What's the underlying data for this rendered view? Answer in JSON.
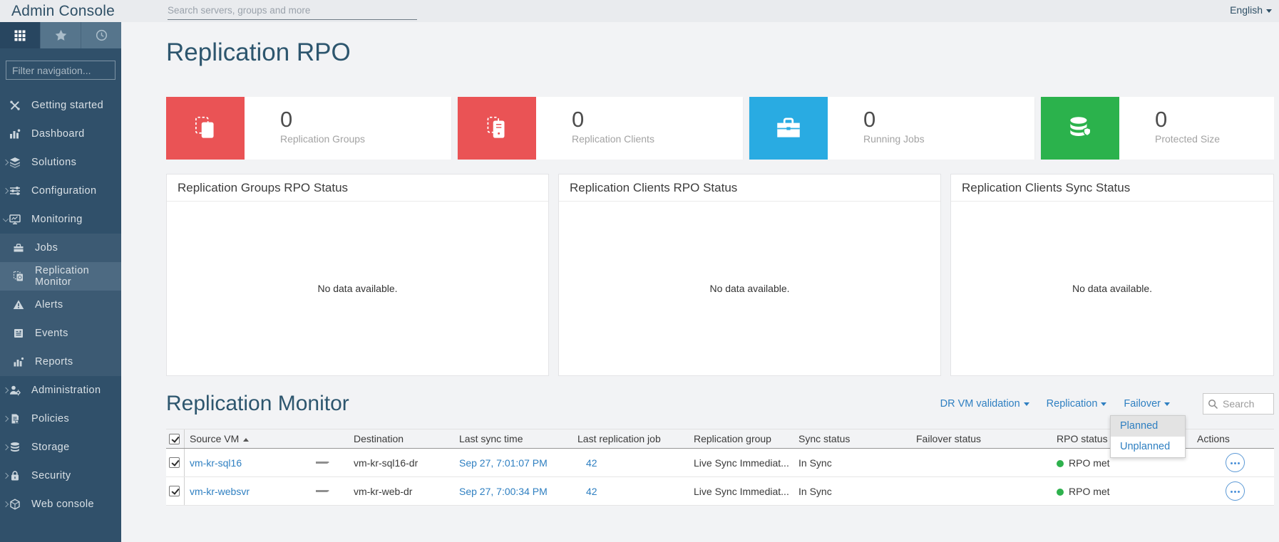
{
  "colors": {
    "sidebar_bg": "#30506a",
    "sidebar_subgroup_bg": "#3c5a73",
    "sidebar_selected_bg": "#4d6a82",
    "topbar_bg": "#e9ebee",
    "page_bg": "#f2f3f5",
    "heading": "#2d566e",
    "link": "#2e7fc1",
    "card_red": "#ea5355",
    "card_blue": "#29abe2",
    "card_green": "#2bb24c",
    "rpo_met_dot": "#2eb14d"
  },
  "topbar": {
    "app_title": "Admin Console",
    "search_placeholder": "Search servers, groups and more",
    "language_label": "English"
  },
  "sidebar": {
    "filter_placeholder": "Filter navigation...",
    "items": [
      {
        "label": "Getting started"
      },
      {
        "label": "Dashboard"
      },
      {
        "label": "Solutions"
      },
      {
        "label": "Configuration"
      },
      {
        "label": "Monitoring"
      },
      {
        "label": "Jobs"
      },
      {
        "label": "Replication Monitor"
      },
      {
        "label": "Alerts"
      },
      {
        "label": "Events"
      },
      {
        "label": "Reports"
      },
      {
        "label": "Administration"
      },
      {
        "label": "Policies"
      },
      {
        "label": "Storage"
      },
      {
        "label": "Security"
      },
      {
        "label": "Web console"
      }
    ]
  },
  "page": {
    "title": "Replication RPO"
  },
  "stats": [
    {
      "value": "0",
      "label": "Replication Groups",
      "color": "#ea5355"
    },
    {
      "value": "0",
      "label": "Replication Clients",
      "color": "#ea5355"
    },
    {
      "value": "0",
      "label": "Running Jobs",
      "color": "#29abe2"
    },
    {
      "value": "0",
      "label": "Protected Size",
      "color": "#2bb24c"
    }
  ],
  "panels": [
    {
      "title": "Replication Groups RPO Status",
      "empty_text": "No data available."
    },
    {
      "title": "Replication Clients RPO Status",
      "empty_text": "No data available."
    },
    {
      "title": "Replication Clients Sync Status",
      "empty_text": "No data available."
    }
  ],
  "monitor": {
    "title": "Replication Monitor",
    "menus": [
      {
        "label": "DR VM validation"
      },
      {
        "label": "Replication"
      },
      {
        "label": "Failover"
      }
    ],
    "search_placeholder": "Search",
    "failover_dropdown": {
      "highlighted": "Planned",
      "items": [
        {
          "label": "Planned"
        },
        {
          "label": "Unplanned"
        }
      ]
    },
    "table": {
      "columns": [
        "Source VM",
        "Destination",
        "Last sync time",
        "Last replication job",
        "Replication group",
        "Sync status",
        "Failover status",
        "RPO status",
        "Actions"
      ],
      "sorted_by": "Source VM",
      "sort_direction": "asc",
      "rows": [
        {
          "source_vm": "vm-kr-sql16",
          "destination": "vm-kr-sql16-dr",
          "last_sync_time": "Sep 27, 7:01:07 PM",
          "last_replication_job": "42",
          "replication_group": "Live Sync Immediat...",
          "sync_status": "In Sync",
          "failover_status": "",
          "rpo_status": "RPO met"
        },
        {
          "source_vm": "vm-kr-websvr",
          "destination": "vm-kr-web-dr",
          "last_sync_time": "Sep 27, 7:00:34 PM",
          "last_replication_job": "42",
          "replication_group": "Live Sync Immediat...",
          "sync_status": "In Sync",
          "failover_status": "",
          "rpo_status": "RPO met"
        }
      ]
    }
  }
}
